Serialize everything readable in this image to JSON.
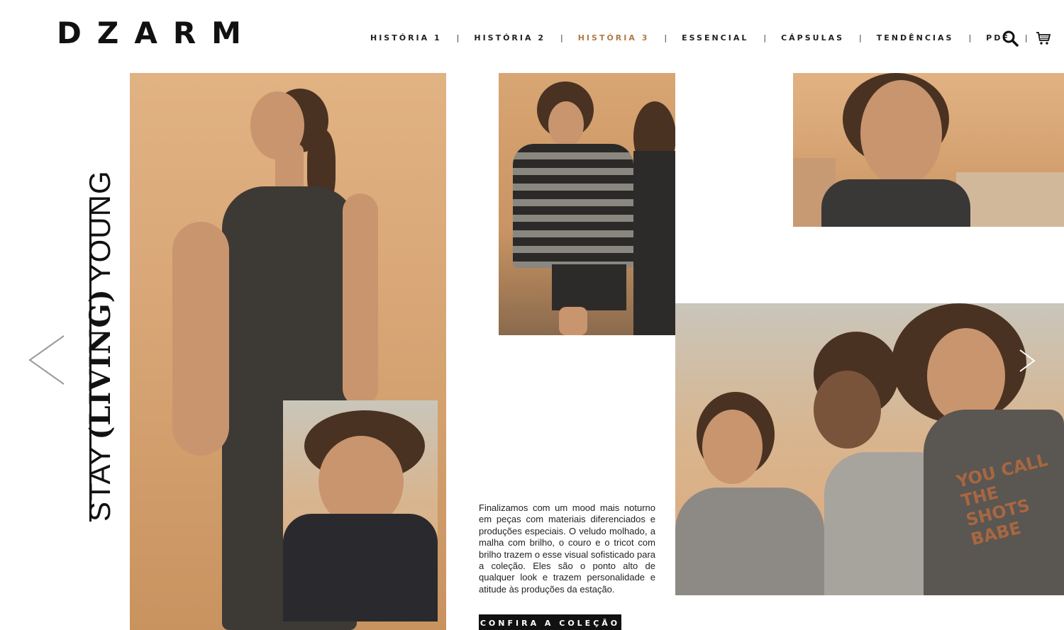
{
  "brand": {
    "logo_text": "DZARM"
  },
  "nav": {
    "items": [
      {
        "label": "HISTÓRIA 1",
        "active": false
      },
      {
        "label": "HISTÓRIA 2",
        "active": false
      },
      {
        "label": "HISTÓRIA 3",
        "active": true
      },
      {
        "label": "ESSENCIAL",
        "active": false
      },
      {
        "label": "CÁPSULAS",
        "active": false
      },
      {
        "label": "TENDÊNCIAS",
        "active": false
      },
      {
        "label": "PDF",
        "active": false
      }
    ],
    "separator": "|",
    "icons": [
      "search-icon",
      "cart-icon"
    ]
  },
  "hero_title": {
    "part1": "STAY",
    "part2": "(LIVING)",
    "part3": "YOUNG"
  },
  "story": {
    "description": "Finalizamos com um mood mais noturno em peças com materiais diferenciados e produções especiais. O veludo molhado, a malha com brilho, o couro e o tricot com brilho trazem o esse visual sofisticado para a coleção. Eles são o ponto alto de qualquer look e trazem personalidade e atitude às produções da estação.",
    "cta_label": "CONFIRA A COLEÇÃO"
  },
  "carousel": {
    "prev_icon": "chevron-left-icon",
    "next_icon": "chevron-right-icon"
  },
  "colors": {
    "accent": "#b07a45",
    "text": "#111111",
    "background": "#ffffff"
  },
  "gallery": {
    "photos": [
      {
        "name": "photo-model-dress",
        "subject": "model in printed dark dress"
      },
      {
        "name": "photo-model-closeup",
        "subject": "model close-up resting on arm"
      },
      {
        "name": "photo-two-models-stripes",
        "subject": "two models, striped sweater"
      },
      {
        "name": "photo-model-portrait",
        "subject": "model portrait with hoop earrings"
      },
      {
        "name": "photo-three-models",
        "subject": "three models smiling"
      }
    ],
    "printed_text_on_tee": "YOU CALL THE SHOTS BABE"
  }
}
